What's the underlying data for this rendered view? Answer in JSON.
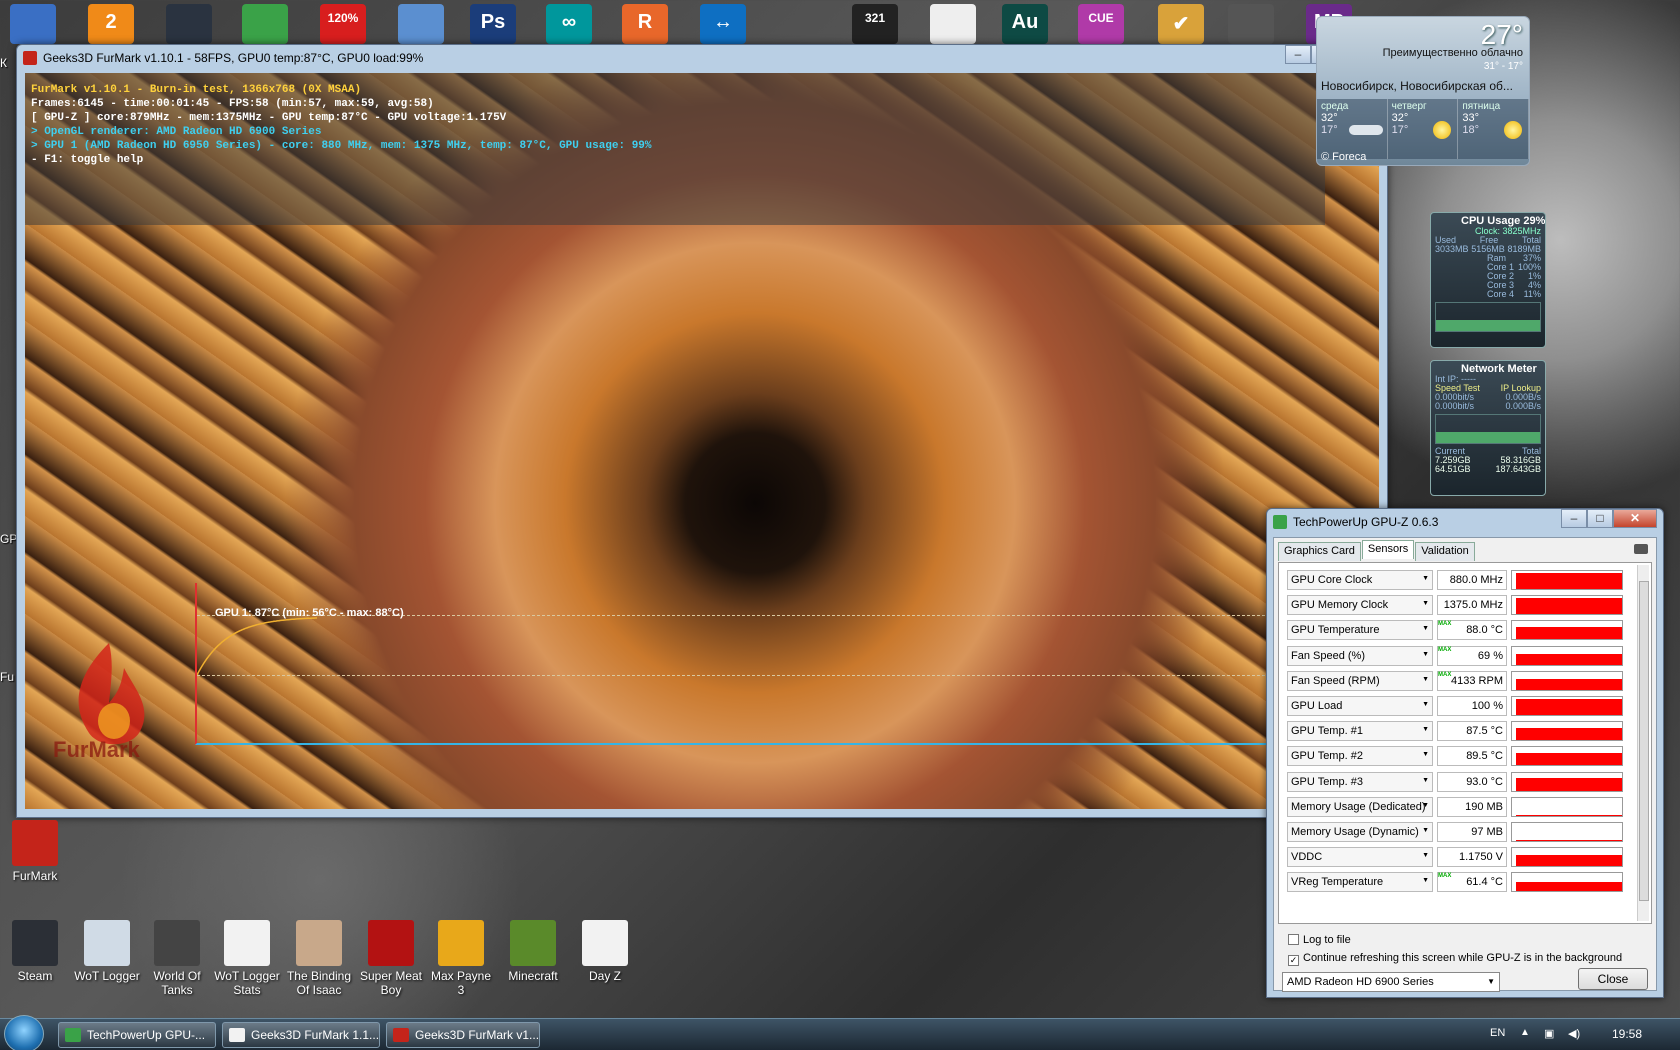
{
  "desktop_left_labels": [
    "К",
    "GP",
    "Fu"
  ],
  "top_icons": [
    {
      "name": "system-icon",
      "color": "#3a6fc4",
      "text": ""
    },
    {
      "name": "aimp-icon",
      "color": "#f08a18",
      "text": "2"
    },
    {
      "name": "fan-icon",
      "color": "#2a3340",
      "text": ""
    },
    {
      "name": "xbmc-icon",
      "color": "#3aa248",
      "text": ""
    },
    {
      "name": "acrobat-icon",
      "color": "#d81e1e",
      "text": "120%"
    },
    {
      "name": "monitor-icon",
      "color": "#5b8fd0",
      "text": ""
    },
    {
      "name": "photoshop-icon",
      "color": "#1b3d7a",
      "text": "Ps"
    },
    {
      "name": "arduino-icon",
      "color": "#00979c",
      "text": "∞"
    },
    {
      "name": "remote-icon",
      "color": "#e8672a",
      "text": "R"
    },
    {
      "name": "teamviewer-icon",
      "color": "#0e6fc2",
      "text": "↔"
    },
    {
      "name": "media-classic-icon",
      "color": "#222",
      "text": "321"
    },
    {
      "name": "cat-icon",
      "color": "#eee",
      "text": ""
    },
    {
      "name": "audition-icon",
      "color": "#0e4a44",
      "text": "Au"
    },
    {
      "name": "cue-icon",
      "color": "#b03aa8",
      "text": "CUE"
    },
    {
      "name": "checkmark-icon",
      "color": "#d9a23a",
      "text": "✔"
    },
    {
      "name": "speaker-icon",
      "color": "#555",
      "text": ""
    },
    {
      "name": "film-icon",
      "color": "#6a2a8a",
      "text": "MP"
    }
  ],
  "furmark": {
    "title": "Geeks3D FurMark v1.10.1 - 58FPS, GPU0 temp:87°C, GPU0 load:99%",
    "osd": [
      {
        "text": "FurMark v1.10.1 - Burn-in test, 1366x768 (0X MSAA)",
        "color": "#ffd23c"
      },
      {
        "text": "Frames:6145 - time:00:01:45 - FPS:58 (min:57, max:59, avg:58)",
        "color": "#ffffff"
      },
      {
        "text": "[ GPU-Z ] core:879MHz - mem:1375MHz - GPU temp:87°C - GPU voltage:1.175V",
        "color": "#ffffff"
      },
      {
        "text": "> OpenGL renderer: AMD Radeon HD 6900 Series",
        "color": "#3fd0f0"
      },
      {
        "text": "> GPU 1 (AMD Radeon HD 6950 Series) - core: 880 MHz, mem: 1375 MHz, temp: 87°C, GPU usage: 99%",
        "color": "#3fd0f0"
      },
      {
        "text": "- F1: toggle help",
        "color": "#ffffff"
      }
    ],
    "graph_label": "GPU 1: 87°C (min: 56°C - max: 88°C)",
    "temp_min": 56,
    "temp_max": 88,
    "temp_current": 87
  },
  "weather": {
    "temp": "27°",
    "condition": "Преимущественно облачно",
    "hi_lo": "31° - 17°",
    "city": "Новосибирск, Новосибирская об...",
    "days": [
      {
        "name": "среда",
        "hi": "32°",
        "lo": "17°",
        "icon": "cloud-icon"
      },
      {
        "name": "четверг",
        "hi": "32°",
        "lo": "17°",
        "icon": "sun-icon"
      },
      {
        "name": "пятница",
        "hi": "33°",
        "lo": "18°",
        "icon": "sun-icon"
      }
    ],
    "footer": "© Foreca"
  },
  "cpu_gadget": {
    "title": "CPU Usage",
    "percent": "29%",
    "clock": "Clock: 3825MHz",
    "mem_heads": [
      "Used",
      "Free",
      "Total"
    ],
    "mem_vals": [
      "3033MB",
      "5156MB",
      "8189MB"
    ],
    "rows": [
      {
        "k": "Ram",
        "v": "37%"
      },
      {
        "k": "Core 1",
        "v": "100%"
      },
      {
        "k": "Core 2",
        "v": "1%"
      },
      {
        "k": "Core 3",
        "v": "4%"
      },
      {
        "k": "Core 4",
        "v": "11%"
      }
    ]
  },
  "net_gadget": {
    "title": "Network Meter",
    "ip": "Int IP: -----",
    "links": [
      "Speed Test",
      "IP Lookup"
    ],
    "speeds": [
      "0.000bit/s",
      "0.000B/s",
      "0.000bit/s",
      "0.000B/s"
    ],
    "heads": [
      "Current",
      "Total"
    ],
    "totals": [
      "7.259GB",
      "58.316GB",
      "64.51GB",
      "187.643GB"
    ]
  },
  "gpuz": {
    "title": "TechPowerUp GPU-Z 0.6.3",
    "tabs": [
      "Graphics Card",
      "Sensors",
      "Validation"
    ],
    "active_tab": 1,
    "sensors": [
      {
        "name": "GPU Core Clock",
        "value": "880.0 MHz",
        "max": false,
        "level": 0.9
      },
      {
        "name": "GPU Memory Clock",
        "value": "1375.0 MHz",
        "max": false,
        "level": 0.9
      },
      {
        "name": "GPU Temperature",
        "value": "88.0 °C",
        "max": true,
        "level": 0.7
      },
      {
        "name": "Fan Speed (%)",
        "value": "69 %",
        "max": true,
        "level": 0.6
      },
      {
        "name": "Fan Speed (RPM)",
        "value": "4133 RPM",
        "max": true,
        "level": 0.6
      },
      {
        "name": "GPU Load",
        "value": "100 %",
        "max": false,
        "level": 0.9
      },
      {
        "name": "GPU Temp. #1",
        "value": "87.5 °C",
        "max": false,
        "level": 0.7
      },
      {
        "name": "GPU Temp. #2",
        "value": "89.5 °C",
        "max": false,
        "level": 0.7
      },
      {
        "name": "GPU Temp. #3",
        "value": "93.0 °C",
        "max": false,
        "level": 0.7
      },
      {
        "name": "Memory Usage (Dedicated)",
        "value": "190 MB",
        "max": false,
        "level": 0.05
      },
      {
        "name": "Memory Usage (Dynamic)",
        "value": "97 MB",
        "max": false,
        "level": 0.03
      },
      {
        "name": "VDDC",
        "value": "1.1750 V",
        "max": false,
        "level": 0.6
      },
      {
        "name": "VReg Temperature",
        "value": "61.4 °C",
        "max": true,
        "level": 0.5
      }
    ],
    "log_to_file": "Log to file",
    "continue_refresh": "Continue refreshing this screen while GPU-Z is in the background",
    "gpu_select": "AMD Radeon HD 6900 Series",
    "close": "Close"
  },
  "desktop_icons": [
    {
      "label": "FurMark",
      "color": "#c4241a",
      "name": "furmark-desktop-icon"
    },
    {
      "label": "Steam",
      "color": "#2b2f36",
      "name": "steam-desktop-icon"
    },
    {
      "label": "WoT Logger",
      "color": "#d0dbe6",
      "name": "wot-logger-desktop-icon"
    },
    {
      "label": "World Of Tanks",
      "color": "#444",
      "name": "world-of-tanks-desktop-icon"
    },
    {
      "label": "WoT Logger Stats",
      "color": "#f2f2f2",
      "name": "wot-logger-stats-desktop-icon"
    },
    {
      "label": "The Binding Of Isaac",
      "color": "#c8a88a",
      "name": "binding-of-isaac-desktop-icon"
    },
    {
      "label": "Super Meat Boy",
      "color": "#b31212",
      "name": "super-meat-boy-desktop-icon"
    },
    {
      "label": "Max Payne 3",
      "color": "#e8a81a",
      "name": "max-payne-3-desktop-icon"
    },
    {
      "label": "Minecraft",
      "color": "#5a8a2a",
      "name": "minecraft-desktop-icon"
    },
    {
      "label": "Day Z",
      "color": "#f2f2f2",
      "name": "day-z-desktop-icon"
    }
  ],
  "taskbar": {
    "items": [
      {
        "label": "TechPowerUp GPU-...",
        "color": "#3aa248"
      },
      {
        "label": "Geeks3D FurMark 1.1...",
        "color": "#f2f2f2"
      },
      {
        "label": "Geeks3D FurMark v1....",
        "color": "#c4241a"
      }
    ],
    "lang": "EN",
    "clock": "19:58"
  }
}
